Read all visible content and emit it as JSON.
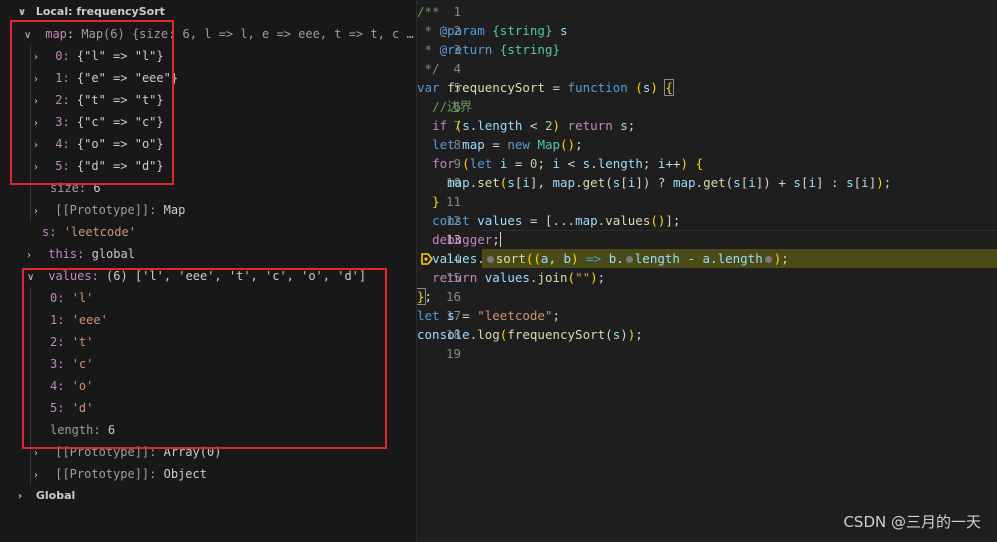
{
  "variables": {
    "local_scope": "Local: frequencySort",
    "map": {
      "name": "map",
      "summary": "Map(6) {size: 6, l => l, e => eee, t => t, c …",
      "entries": [
        {
          "key": "0:",
          "val": "{\"l\" => \"l\"}"
        },
        {
          "key": "1:",
          "val": "{\"e\" => \"eee\"}"
        },
        {
          "key": "2:",
          "val": "{\"t\" => \"t\"}"
        },
        {
          "key": "3:",
          "val": "{\"c\" => \"c\"}"
        },
        {
          "key": "4:",
          "val": "{\"o\" => \"o\"}"
        },
        {
          "key": "5:",
          "val": "{\"d\" => \"d\"}"
        }
      ],
      "size_label": "size:",
      "size_value": "6",
      "proto_label": "[[Prototype]]:",
      "proto_value": "Map"
    },
    "s": {
      "name": "s:",
      "value": "'leetcode'"
    },
    "this": {
      "name": "this:",
      "value": "global"
    },
    "values": {
      "name": "values:",
      "summary": "(6) ['l', 'eee', 't', 'c', 'o', 'd']",
      "items": [
        {
          "key": "0:",
          "val": "'l'"
        },
        {
          "key": "1:",
          "val": "'eee'"
        },
        {
          "key": "2:",
          "val": "'t'"
        },
        {
          "key": "3:",
          "val": "'c'"
        },
        {
          "key": "4:",
          "val": "'o'"
        },
        {
          "key": "5:",
          "val": "'d'"
        }
      ],
      "length_label": "length:",
      "length_value": "6",
      "proto1_label": "[[Prototype]]:",
      "proto1_value": "Array(0)",
      "proto2_label": "[[Prototype]]:",
      "proto2_value": "Object"
    },
    "global_scope": "Global"
  },
  "editor": {
    "line_numbers": [
      "1",
      "2",
      "3",
      "4",
      "5",
      "6",
      "7",
      "8",
      "9",
      "10",
      "11",
      "12",
      "13",
      "14",
      "15",
      "16",
      "17",
      "18",
      "19"
    ],
    "active_line": "13",
    "paused_line": "14"
  },
  "watermark": "CSDN @三月的一天"
}
